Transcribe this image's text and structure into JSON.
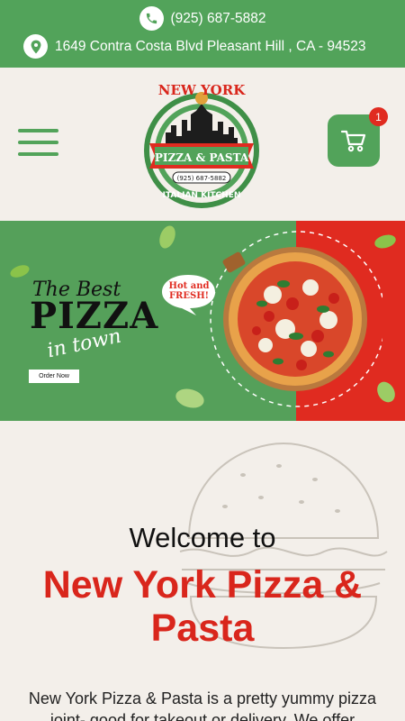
{
  "topbar": {
    "phone": "(925) 687-5882",
    "address": "1649 Contra Costa Blvd Pleasant Hill , CA - 94523",
    "phone_icon": "phone-icon",
    "location_icon": "location-pin-icon"
  },
  "header": {
    "logo": {
      "line1": "NEW YORK",
      "line2": "PIZZA & PASTA",
      "phone": "(925) 687-5882",
      "line3": "ITALIAN KITCHEN"
    },
    "cart_count": "1",
    "menu_icon": "hamburger-menu-icon",
    "cart_icon": "shopping-cart-icon"
  },
  "hero": {
    "tagline_1": "The Best",
    "tagline_2": "PIZZA",
    "tagline_3": "in town",
    "bubble": "Hot and FRESH!",
    "order_button": "Order Now"
  },
  "welcome": {
    "heading": "Welcome to",
    "name": "New York Pizza & Pasta",
    "description": "New York Pizza & Pasta is a pretty yummy pizza joint- good for takeout or delivery. We offer"
  },
  "colors": {
    "brand_green": "#52a35a",
    "brand_red": "#e02b20",
    "background": "#f3efea"
  }
}
